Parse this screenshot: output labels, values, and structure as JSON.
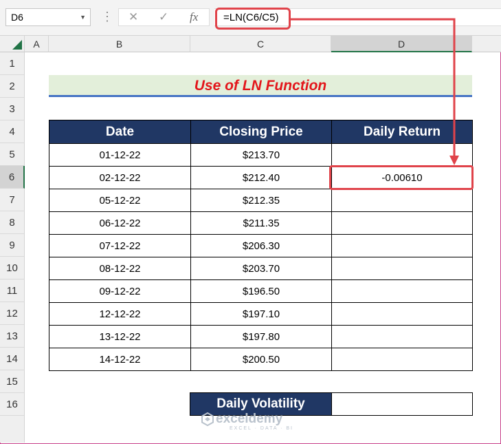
{
  "formula_bar": {
    "name_box": "D6",
    "cancel_glyph": "✕",
    "enter_glyph": "✓",
    "fx_glyph": "fx",
    "formula": "=LN(C6/C5)"
  },
  "columns": [
    "A",
    "B",
    "C",
    "D"
  ],
  "rows": [
    "1",
    "2",
    "3",
    "4",
    "5",
    "6",
    "7",
    "8",
    "9",
    "10",
    "11",
    "12",
    "13",
    "14",
    "15",
    "16"
  ],
  "active_cell": {
    "column": "D",
    "row": "6"
  },
  "title": "Use of LN Function",
  "table": {
    "headers": [
      "Date",
      "Closing Price",
      "Daily Return"
    ],
    "rows": [
      [
        "01-12-22",
        "$213.70",
        ""
      ],
      [
        "02-12-22",
        "$212.40",
        "-0.00610"
      ],
      [
        "05-12-22",
        "$212.35",
        ""
      ],
      [
        "06-12-22",
        "$211.35",
        ""
      ],
      [
        "07-12-22",
        "$206.30",
        ""
      ],
      [
        "08-12-22",
        "$203.70",
        ""
      ],
      [
        "09-12-22",
        "$196.50",
        ""
      ],
      [
        "12-12-22",
        "$197.10",
        ""
      ],
      [
        "13-12-22",
        "$197.80",
        ""
      ],
      [
        "14-12-22",
        "$200.50",
        ""
      ]
    ]
  },
  "volatility": {
    "label": "Daily Volatility",
    "value": ""
  },
  "watermark": {
    "name": "exceldemy",
    "tagline": "EXCEL · DATA · BI"
  },
  "colors": {
    "header_fill": "#203764",
    "title_text": "#e3161b",
    "title_fill": "#e3efda",
    "highlight": "#e0434a",
    "excel_green": "#217346"
  }
}
